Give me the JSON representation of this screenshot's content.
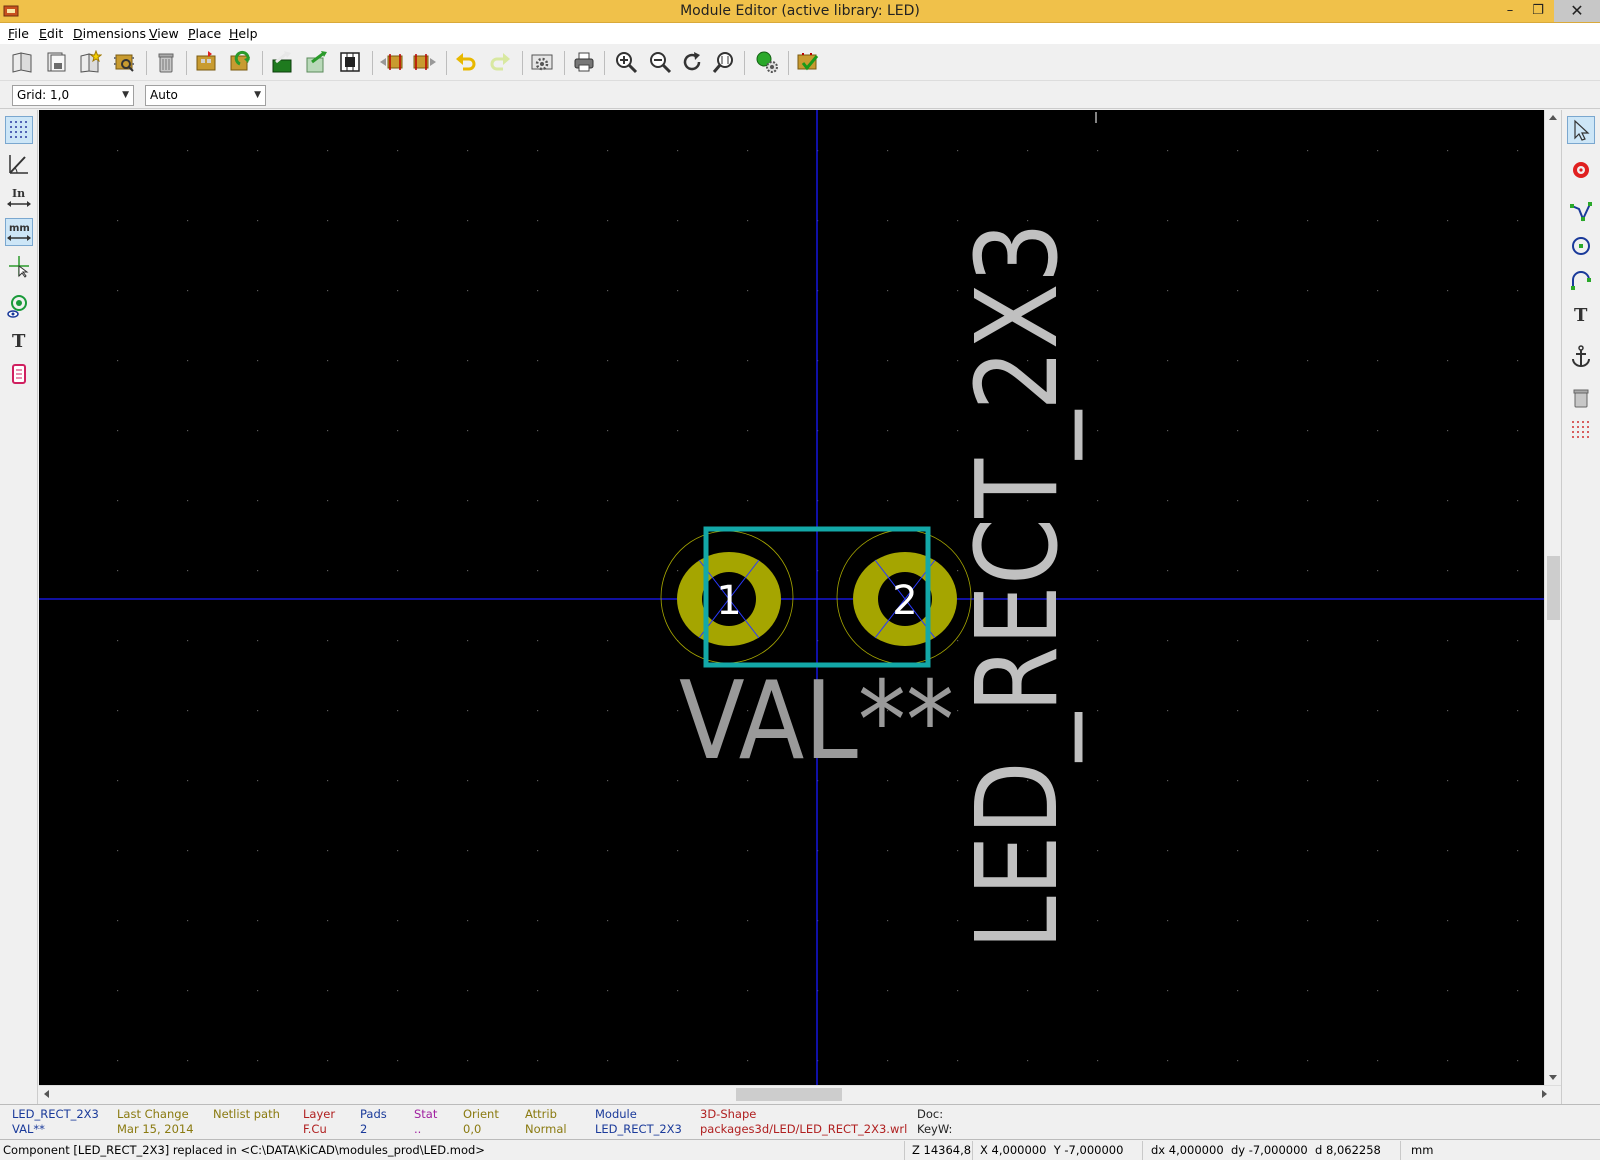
{
  "window": {
    "title": "Module Editor (active library: LED)",
    "minimize": "–",
    "restore": "❐",
    "close": "✕"
  },
  "menu": [
    "File",
    "Edit",
    "Dimensions",
    "View",
    "Place",
    "Help"
  ],
  "options": {
    "grid": "Grid: 1,0",
    "zoom": "Auto"
  },
  "toolbar_icons": [
    "select-lib-icon",
    "save-lib-icon",
    "new-module-icon",
    "load-module-icon",
    "delete-module-icon",
    "load-from-board-icon",
    "load-from-lib-icon",
    "insert-into-board-icon",
    "update-board-icon",
    "module-properties-icon",
    "module-anchor-left-icon",
    "module-anchor-right-icon",
    "undo-icon",
    "redo-icon",
    "pad-settings-icon",
    "print-icon",
    "zoom-in-icon",
    "zoom-out-icon",
    "redraw-icon",
    "zoom-fit-icon",
    "3d-viewer-icon",
    "check-icon"
  ],
  "canvas": {
    "reference_text": "LED_RECT_2X3",
    "value_text": "VAL**",
    "pad1_label": "1",
    "pad2_label": "2",
    "colors": {
      "background": "#000000",
      "grid": "#5a5a5a",
      "axis": "#1a1aff",
      "pad": "#a5a500",
      "outline": "#13a8a8",
      "text": "#c0c0c0",
      "value_text": "#9a9a9a"
    }
  },
  "msgpanel": {
    "ref": "LED_RECT_2X3",
    "val": "VAL**",
    "last_change_label": "Last Change",
    "last_change": "Mar 15, 2014",
    "netlist_label": "Netlist path",
    "netlist": "",
    "layer_label": "Layer",
    "layer": "F.Cu",
    "pads_label": "Pads",
    "pads": "2",
    "stat_label": "Stat",
    "stat": "..",
    "orient_label": "Orient",
    "orient": "0,0",
    "attrib_label": "Attrib",
    "attrib": "Normal",
    "module_label": "Module",
    "module": "LED_RECT_2X3",
    "shape_label": "3D-Shape",
    "shape": "packages3d/LED/LED_RECT_2X3.wrl",
    "doc_label": "Doc:",
    "keyw_label": "KeyW:"
  },
  "status": {
    "message": "Component [LED_RECT_2X3] replaced in <C:\\DATA\\KiCAD\\modules_prod\\LED.mod>",
    "zoom": "Z 14364,8",
    "xy": "X 4,000000  Y -7,000000",
    "delta": "dx 4,000000  dy -7,000000  d 8,062258",
    "units": "mm"
  }
}
